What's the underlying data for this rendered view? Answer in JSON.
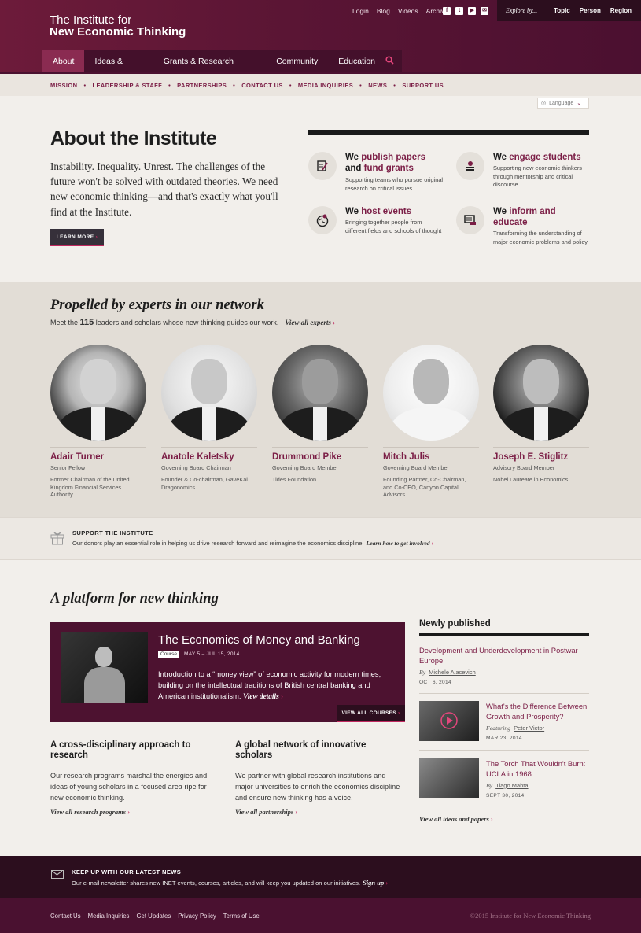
{
  "logo": {
    "line1": "The Institute for",
    "line2": "New Economic Thinking"
  },
  "util": [
    "Login",
    "Blog",
    "Videos",
    "Archive"
  ],
  "explore": {
    "label": "Explore by...",
    "options": [
      "Topic",
      "Person",
      "Region"
    ]
  },
  "nav": [
    "About",
    "Ideas & Papers",
    "Grants & Research Programs",
    "Community",
    "Education"
  ],
  "subnav": [
    "MISSION",
    "LEADERSHIP & STAFF",
    "PARTNERSHIPS",
    "CONTACT US",
    "MEDIA INQUIRIES",
    "NEWS",
    "SUPPORT US"
  ],
  "language": "Language",
  "about": {
    "title": "About the Institute",
    "text": "Instability. Inequality. Unrest. The challenges of the future won't be solved with outdated theories. We need new economic thinking—and that's exactly what you'll find at the Institute.",
    "button": "LEARN MORE",
    "features": [
      {
        "pre": "We ",
        "m1": "publish papers",
        "mid": " and ",
        "m2": "fund grants",
        "desc": "Supporting teams who pursue original research on critical issues"
      },
      {
        "pre": "We ",
        "m1": "engage students",
        "mid": "",
        "m2": "",
        "desc": "Supporting new economic thinkers through mentorship and critical discourse"
      },
      {
        "pre": "We ",
        "m1": "host events",
        "mid": "",
        "m2": "",
        "desc": "Bringing together people from different fields and schools of thought"
      },
      {
        "pre": "We ",
        "m1": "inform and educate",
        "mid": "",
        "m2": "",
        "desc": "Transforming the understanding of major economic problems and policy"
      }
    ]
  },
  "experts": {
    "title": "Propelled by experts in our network",
    "sub_pre": "Meet the ",
    "count": "115",
    "sub_post": " leaders and scholars whose new thinking guides our work.",
    "link": "View all experts",
    "people": [
      {
        "name": "Adair Turner",
        "role": "Senior Fellow",
        "desc": "Former Chairman of the United Kingdom Financial Services Authority"
      },
      {
        "name": "Anatole Kaletsky",
        "role": "Governing Board Chairman",
        "desc": "Founder & Co-chairman, GaveKal Dragonomics"
      },
      {
        "name": "Drummond Pike",
        "role": "Governing Board Member",
        "desc": "Tides Foundation"
      },
      {
        "name": "Mitch Julis",
        "role": "Governing Board Member",
        "desc": "Founding Partner, Co-Chairman, and Co-CEO, Canyon Capital Advisors"
      },
      {
        "name": "Joseph E. Stiglitz",
        "role": "Advisory Board Member",
        "desc": "Nobel Laureate in Economics"
      }
    ]
  },
  "support": {
    "title": "SUPPORT THE INSTITUTE",
    "text": "Our donors play an essential role in helping us drive research forward and reimagine the economics discipline.",
    "link": "Learn how to get involved"
  },
  "platform": {
    "title": "A platform for new thinking",
    "course": {
      "title": "The Economics of Money and Banking",
      "tag": "Course",
      "date": "MAY 5 – JUL 15, 2014",
      "desc": "Introduction to a “money view” of economic activity for modern times, building on the intellectual traditions of British central banking and American institutionalism.",
      "link": "View details",
      "all": "VIEW ALL COURSES"
    },
    "cols": [
      {
        "head": "A cross-disciplinary approach to research",
        "text": "Our research programs marshal the energies and ideas of young scholars in a focused area ripe for new economic thinking.",
        "link": "View all research programs"
      },
      {
        "head": "A global network of innovative scholars",
        "text": "We partner with global research institutions and major universities to enrich the economics discipline and ensure new thinking has a voice.",
        "link": "View all partnerships"
      }
    ]
  },
  "newly": {
    "title": "Newly published",
    "items": [
      {
        "title": "Development and Underdevelopment in Postwar Europe",
        "by": "By",
        "author": "Michele Alacevich",
        "date": "OCT 6, 2014"
      },
      {
        "title": "What's the Difference Between Growth and Prosperity?",
        "by": "Featuring",
        "author": "Peter Victor",
        "date": "MAR 23, 2014"
      },
      {
        "title": "The Torch That Wouldn't Burn: UCLA in 1968",
        "by": "By",
        "author": "Tiago Mahta",
        "date": "SEPT 30, 2014"
      }
    ],
    "all": "View all ideas and papers"
  },
  "news": {
    "title": "KEEP UP WITH OUR LATEST NEWS",
    "text": "Our e-mail newsletter shares new INET events, courses, articles, and will keep you updated on our initiatives.",
    "link": "Sign up"
  },
  "footer": {
    "links": [
      "Contact Us",
      "Media Inquiries",
      "Get Updates",
      "Privacy Policy",
      "Terms of Use"
    ],
    "copy": "©2015 Institute for New Economic Thinking"
  }
}
